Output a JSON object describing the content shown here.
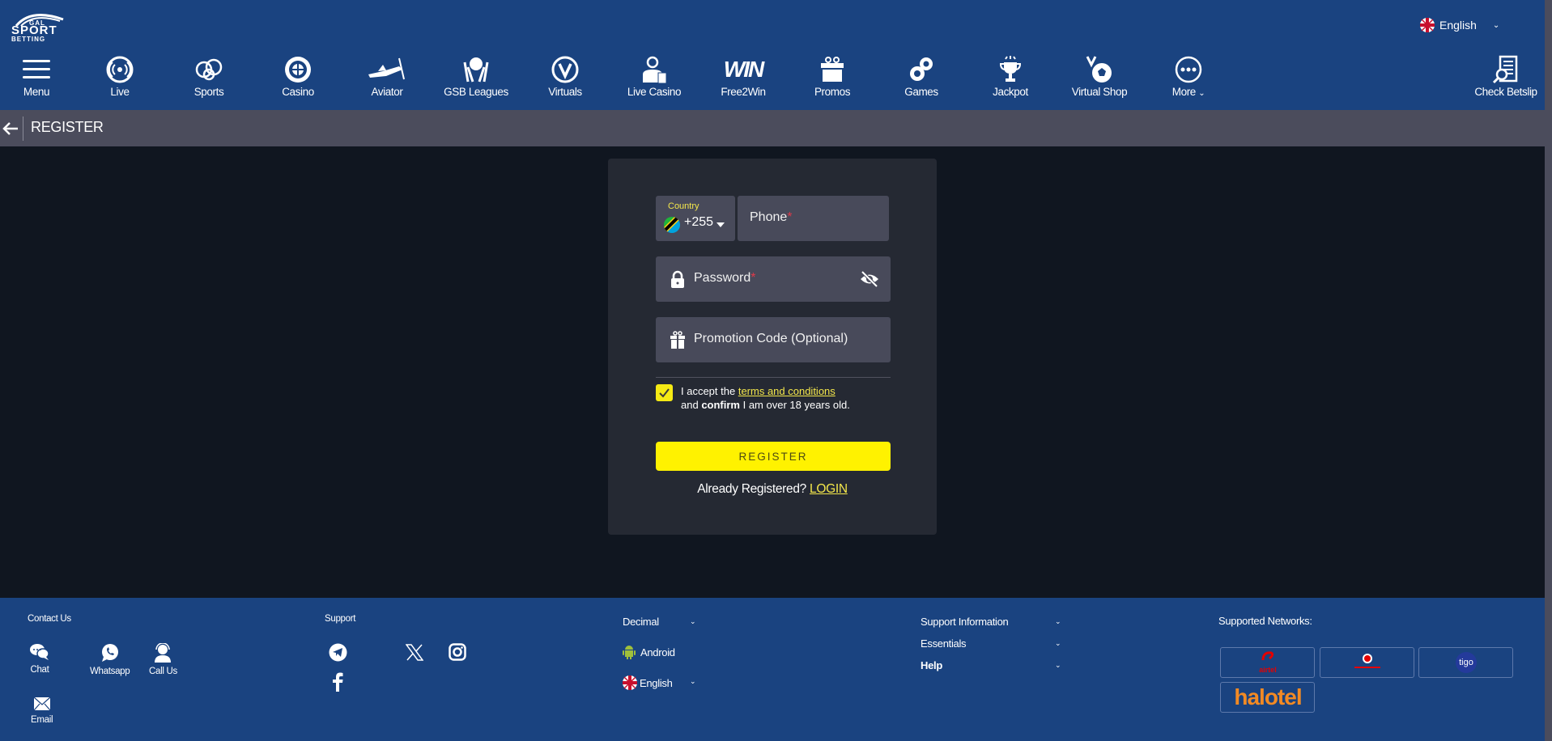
{
  "header": {
    "logo": {
      "line1": "GAL",
      "line2": "SPORT",
      "line3": "BETTING"
    },
    "language": "English",
    "nav": [
      {
        "label": "Menu",
        "icon": "menu-icon"
      },
      {
        "label": "Live",
        "icon": "live-icon"
      },
      {
        "label": "Sports",
        "icon": "sports-icon"
      },
      {
        "label": "Casino",
        "icon": "casino-icon"
      },
      {
        "label": "Aviator",
        "icon": "aviator-icon"
      },
      {
        "label": "GSB Leagues",
        "icon": "leagues-icon"
      },
      {
        "label": "Virtuals",
        "icon": "virtuals-icon"
      },
      {
        "label": "Live Casino",
        "icon": "live-casino-icon"
      },
      {
        "label": "Free2Win",
        "icon": "free2win-icon"
      },
      {
        "label": "Promos",
        "icon": "gift-icon"
      },
      {
        "label": "Games",
        "icon": "games-icon"
      },
      {
        "label": "Jackpot",
        "icon": "trophy-icon"
      },
      {
        "label": "Virtual Shop",
        "icon": "virtual-shop-icon"
      },
      {
        "label": "More",
        "icon": "more-icon"
      },
      {
        "label": "Check Betslip",
        "icon": "betslip-icon"
      }
    ],
    "free2win_logo_text": "WIN"
  },
  "subheader": {
    "title": "REGISTER"
  },
  "form": {
    "country_label": "Country",
    "country_code": "+255",
    "phone_placeholder": "Phone",
    "password_placeholder": "Password",
    "required_mark": "*",
    "promo_placeholder": "Promotion Code (Optional)",
    "terms": {
      "prefix": "I accept the ",
      "link": "terms and conditions",
      "line2_prefix": "and ",
      "line2_bold": "confirm",
      "line2_suffix": " I am over 18 years old.",
      "checked": true
    },
    "register_button": "REGISTER",
    "already_text": "Already Registered? ",
    "login_link": "LOGIN"
  },
  "footer": {
    "contact_title": "Contact Us",
    "contact": [
      {
        "label": "Chat",
        "icon": "chat-icon"
      },
      {
        "label": "Whatsapp",
        "icon": "whatsapp-icon"
      },
      {
        "label": "Call Us",
        "icon": "call-agent-icon"
      },
      {
        "label": "Email",
        "icon": "email-icon"
      }
    ],
    "support_title": "Support",
    "social": [
      "telegram-icon",
      "x-icon",
      "instagram-icon",
      "facebook-icon"
    ],
    "odds_format": "Decimal",
    "android": "Android",
    "language": "English",
    "links": [
      "Support Information",
      "Essentials",
      "Help"
    ],
    "networks_title": "Supported Networks:",
    "networks": [
      "airtel",
      "vodacom",
      "tigo",
      "halotel"
    ]
  },
  "colors": {
    "header_bg": "#1a4380",
    "subbar_bg": "#4b4c5c",
    "page_bg": "#101620",
    "card_bg": "#252933",
    "field_bg": "#484a5a",
    "accent_yellow": "#fff200",
    "required_red": "#e03a4a"
  }
}
